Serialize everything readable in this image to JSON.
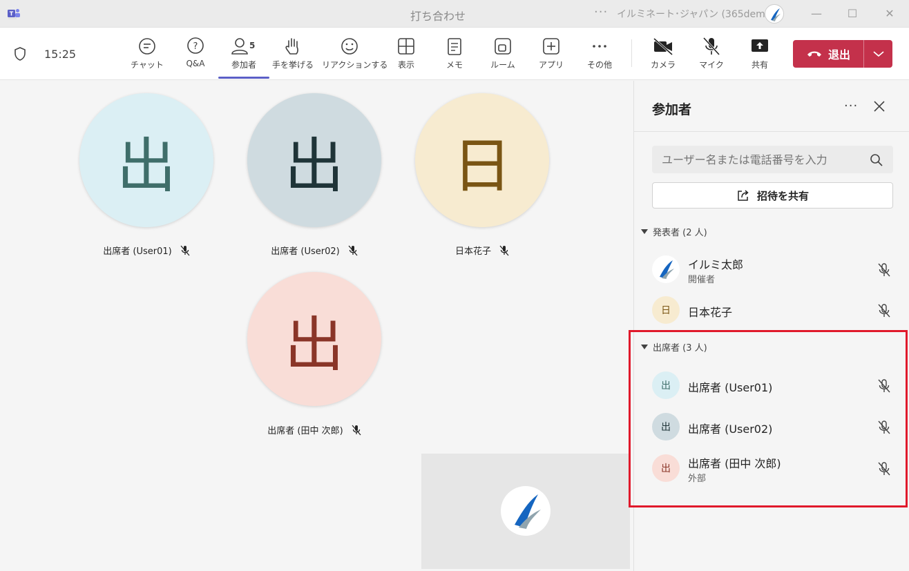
{
  "window": {
    "title": "打ち合わせ",
    "org_name": "イルミネート･ジャパン (365demo1)",
    "more": "···"
  },
  "toolbar": {
    "time": "15:25",
    "buttons": {
      "chat": "チャット",
      "qa": "Q&A",
      "participants": "参加者",
      "participants_count": "5",
      "raise_hand": "手を挙げる",
      "reactions": "リアクションする",
      "view": "表示",
      "notes": "メモ",
      "rooms": "ルーム",
      "apps": "アプリ",
      "more": "その他",
      "camera": "カメラ",
      "mic": "マイク",
      "share": "共有"
    },
    "leave_label": "退出",
    "accent": "#5b5fc7",
    "leave_color": "#c4314b"
  },
  "stage": {
    "tiles": [
      {
        "initial": "出",
        "name": "出席者 (User01)",
        "bg": "#dbeff4",
        "fg": "#3f6e6a"
      },
      {
        "initial": "出",
        "name": "出席者 (User02)",
        "bg": "#cfdbe0",
        "fg": "#1f3438"
      },
      {
        "initial": "日",
        "name": "日本花子",
        "bg": "#f7ebd0",
        "fg": "#7a5514"
      },
      {
        "initial": "出",
        "name": "出席者 (田中 次郎)",
        "bg": "#f9ddd7",
        "fg": "#8a3528"
      }
    ]
  },
  "panel": {
    "title": "参加者",
    "more": "···",
    "search_placeholder": "ユーザー名または電話番号を入力",
    "share_invite": "招待を共有",
    "presenters": {
      "header": "発表者 (2 人)",
      "people": [
        {
          "name": "イルミ太郎",
          "role": "開催者"
        },
        {
          "initial": "日",
          "name": "日本花子"
        }
      ]
    },
    "attendees": {
      "header": "出席者 (3 人)",
      "people": [
        {
          "initial": "出",
          "name": "出席者 (User01)"
        },
        {
          "initial": "出",
          "name": "出席者 (User02)"
        },
        {
          "initial": "出",
          "name": "出席者 (田中 次郎)",
          "role": "外部"
        }
      ]
    },
    "highlight_color": "#e0192b"
  }
}
